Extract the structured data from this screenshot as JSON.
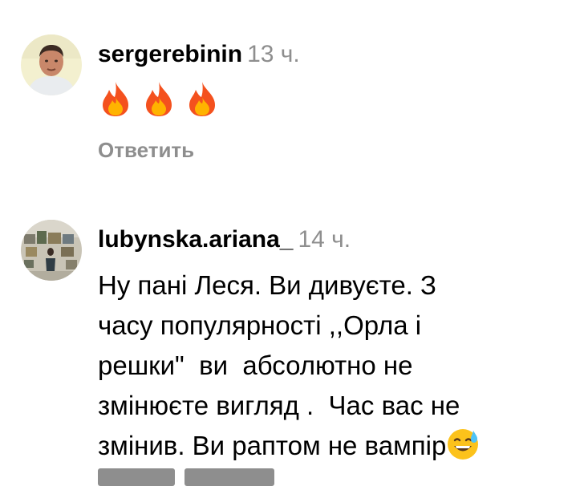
{
  "comments": [
    {
      "username": "sergerebinin",
      "time": "13 ч.",
      "emoji": [
        "fire-icon",
        "fire-icon",
        "fire-icon"
      ],
      "reply_label": "Ответить"
    },
    {
      "username": "lubynska.ariana_",
      "time": "14 ч.",
      "lines": [
        "Ну пані Леся. Ви дивуєте. З",
        "часу популярності ,,Орла і",
        "решки\"  ви  абсолютно не",
        "змінюєте вигляд .  Час вас не",
        "змінив. Ви раптом не вампір"
      ],
      "trailing_emoji": "grinning-sweat-face-icon"
    }
  ],
  "colors": {
    "secondary_text": "#8e8e8e",
    "fire_outer": "#f4511e",
    "fire_inner": "#ffb300"
  }
}
